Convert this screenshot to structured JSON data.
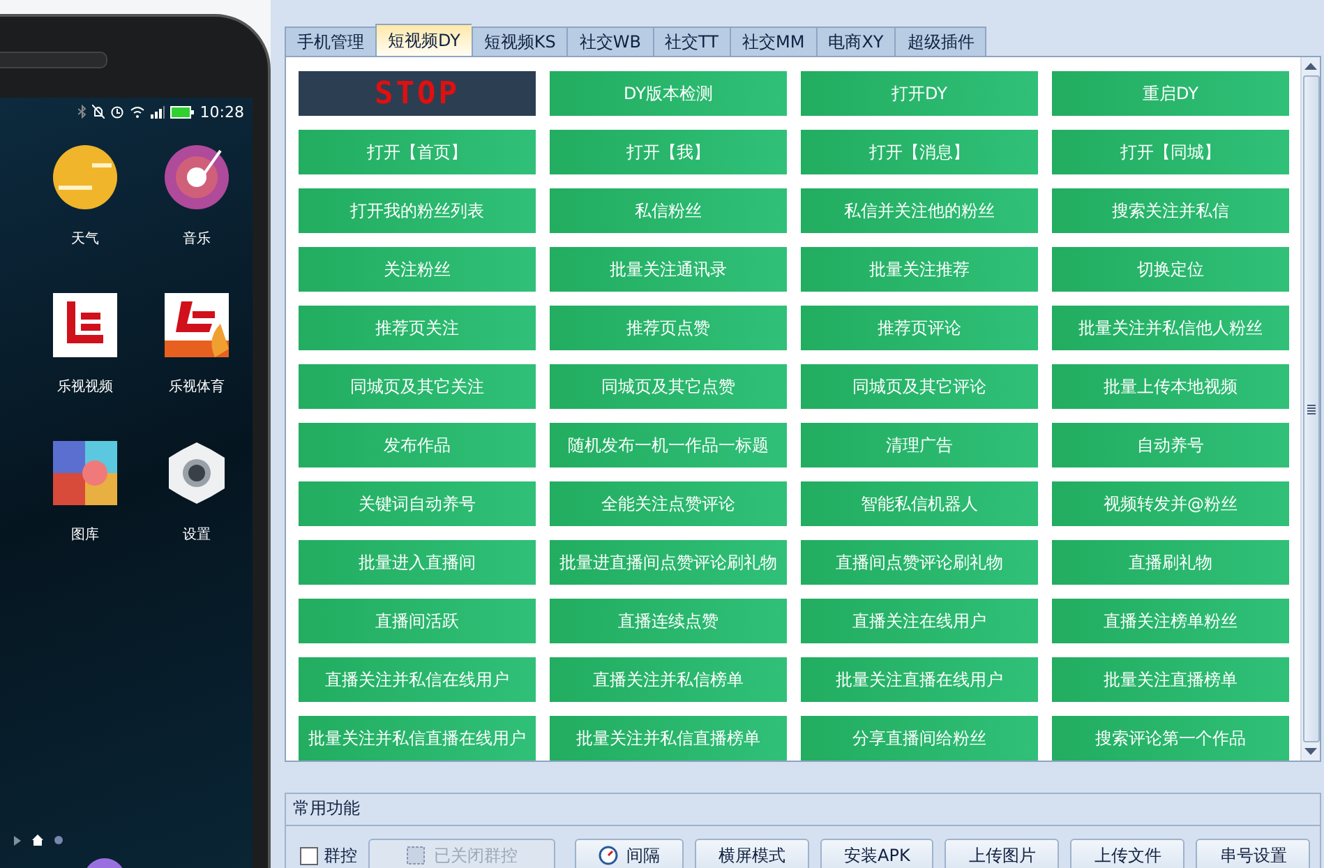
{
  "phone": {
    "status_time": "10:28",
    "apps": [
      {
        "label": "天气",
        "kind": "weather"
      },
      {
        "label": "音乐",
        "kind": "music"
      },
      {
        "label": "乐视视频",
        "kind": "video"
      },
      {
        "label": "乐视体育",
        "kind": "sports"
      },
      {
        "label": "图库",
        "kind": "gallery"
      },
      {
        "label": "设置",
        "kind": "settings"
      }
    ],
    "pages": [
      {
        "kind": "home",
        "selected": true
      },
      {
        "kind": "dot",
        "selected": false
      }
    ]
  },
  "tabs": [
    {
      "label": "手机管理",
      "selected": false
    },
    {
      "label": "短视频DY",
      "selected": true
    },
    {
      "label": "短视频KS",
      "selected": false
    },
    {
      "label": "社交WB",
      "selected": false
    },
    {
      "label": "社交TT",
      "selected": false
    },
    {
      "label": "社交MM",
      "selected": false
    },
    {
      "label": "电商XY",
      "selected": false
    },
    {
      "label": "超级插件",
      "selected": false
    }
  ],
  "actions": [
    {
      "label": "STOP",
      "kind": "stop"
    },
    {
      "label": "DY版本检测",
      "kind": "action"
    },
    {
      "label": "打开DY",
      "kind": "action"
    },
    {
      "label": "重启DY",
      "kind": "action"
    },
    {
      "label": "打开【首页】",
      "kind": "action"
    },
    {
      "label": "打开【我】",
      "kind": "action"
    },
    {
      "label": "打开【消息】",
      "kind": "action"
    },
    {
      "label": "打开【同城】",
      "kind": "action"
    },
    {
      "label": "打开我的粉丝列表",
      "kind": "action"
    },
    {
      "label": "私信粉丝",
      "kind": "action"
    },
    {
      "label": "私信并关注他的粉丝",
      "kind": "action"
    },
    {
      "label": "搜索关注并私信",
      "kind": "action"
    },
    {
      "label": "关注粉丝",
      "kind": "action"
    },
    {
      "label": "批量关注通讯录",
      "kind": "action"
    },
    {
      "label": "批量关注推荐",
      "kind": "action"
    },
    {
      "label": "切换定位",
      "kind": "action"
    },
    {
      "label": "推荐页关注",
      "kind": "action"
    },
    {
      "label": "推荐页点赞",
      "kind": "action"
    },
    {
      "label": "推荐页评论",
      "kind": "action"
    },
    {
      "label": "批量关注并私信他人粉丝",
      "kind": "action"
    },
    {
      "label": "同城页及其它关注",
      "kind": "action"
    },
    {
      "label": "同城页及其它点赞",
      "kind": "action"
    },
    {
      "label": "同城页及其它评论",
      "kind": "action"
    },
    {
      "label": "批量上传本地视频",
      "kind": "action"
    },
    {
      "label": "发布作品",
      "kind": "action"
    },
    {
      "label": "随机发布一机一作品一标题",
      "kind": "action"
    },
    {
      "label": "清理广告",
      "kind": "action"
    },
    {
      "label": "自动养号",
      "kind": "action"
    },
    {
      "label": "关键词自动养号",
      "kind": "action"
    },
    {
      "label": "全能关注点赞评论",
      "kind": "action"
    },
    {
      "label": "智能私信机器人",
      "kind": "action"
    },
    {
      "label": "视频转发并@粉丝",
      "kind": "action"
    },
    {
      "label": "批量进入直播间",
      "kind": "action"
    },
    {
      "label": "批量进直播间点赞评论刷礼物",
      "kind": "action"
    },
    {
      "label": "直播间点赞评论刷礼物",
      "kind": "action"
    },
    {
      "label": "直播刷礼物",
      "kind": "action"
    },
    {
      "label": "直播间活跃",
      "kind": "action"
    },
    {
      "label": "直播连续点赞",
      "kind": "action"
    },
    {
      "label": "直播关注在线用户",
      "kind": "action"
    },
    {
      "label": "直播关注榜单粉丝",
      "kind": "action"
    },
    {
      "label": "直播关注并私信在线用户",
      "kind": "action"
    },
    {
      "label": "直播关注并私信榜单",
      "kind": "action"
    },
    {
      "label": "批量关注直播在线用户",
      "kind": "action"
    },
    {
      "label": "批量关注直播榜单",
      "kind": "action"
    },
    {
      "label": "批量关注并私信直播在线用户",
      "kind": "action"
    },
    {
      "label": "批量关注并私信直播榜单",
      "kind": "action"
    },
    {
      "label": "分享直播间给粉丝",
      "kind": "action"
    },
    {
      "label": "搜索评论第一个作品",
      "kind": "action"
    }
  ],
  "common": {
    "title": "常用功能",
    "group_control": {
      "label": "群控",
      "checked": false
    },
    "buttons": [
      {
        "label": "已关闭群控",
        "kind": "group",
        "disabled": true
      },
      {
        "label": "间隔",
        "kind": "interval",
        "disabled": false
      },
      {
        "label": "横屏模式",
        "kind": "plain",
        "disabled": false
      },
      {
        "label": "安装APK",
        "kind": "plain",
        "disabled": false
      },
      {
        "label": "上传图片",
        "kind": "plain",
        "disabled": false
      },
      {
        "label": "上传文件",
        "kind": "plain",
        "disabled": false
      },
      {
        "label": "串号设置",
        "kind": "plain",
        "disabled": false
      }
    ]
  }
}
